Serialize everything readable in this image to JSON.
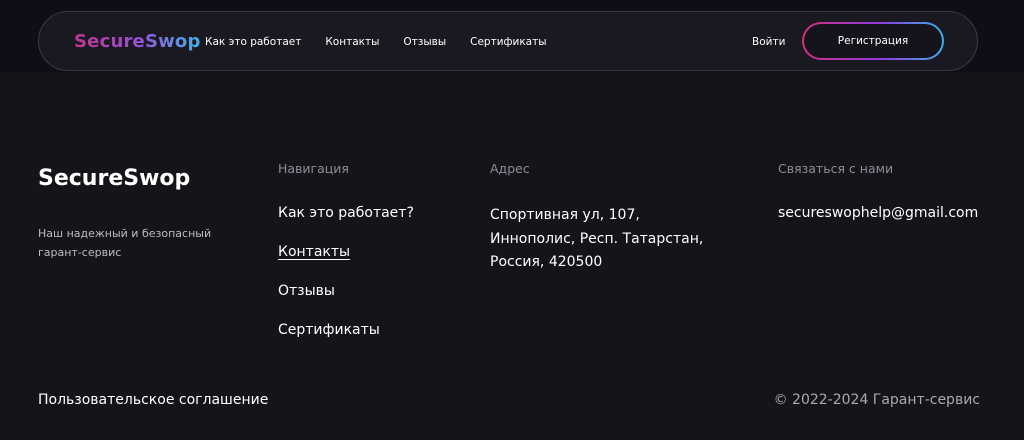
{
  "header": {
    "logo": "SecureSwop",
    "nav": [
      {
        "label": "Как это работает"
      },
      {
        "label": "Контакты"
      },
      {
        "label": "Отзывы"
      },
      {
        "label": "Сертификаты"
      }
    ],
    "login_label": "Войти",
    "register_label": "Регистрация"
  },
  "footer": {
    "brand": "SecureSwop",
    "tagline": "Наш надежный и безопасный гарант-сервис",
    "navigation": {
      "title": "Навигация",
      "items": [
        {
          "label": "Как это работает?"
        },
        {
          "label": "Контакты"
        },
        {
          "label": "Отзывы"
        },
        {
          "label": "Сертификаты"
        }
      ]
    },
    "address": {
      "title": "Адрес",
      "lines": [
        "Спортивная ул, 107,",
        "Иннополис, Респ. Татарстан,",
        "Россия, 420500"
      ]
    },
    "contact": {
      "title": "Связаться с нами",
      "email": "secureswophelp@gmail.com"
    },
    "agreement": "Пользовательское соглашение",
    "copyright": "© 2022-2024 Гарант-сервис"
  },
  "colors": {
    "background": "#15141b",
    "header_background": "#1a1921",
    "muted_text": "#8e8d96",
    "logo_gradient_start": "#c2348f",
    "logo_gradient_end": "#3fb4e8",
    "button_border_start": "#d52e7c",
    "button_border_end": "#3aaee8"
  }
}
